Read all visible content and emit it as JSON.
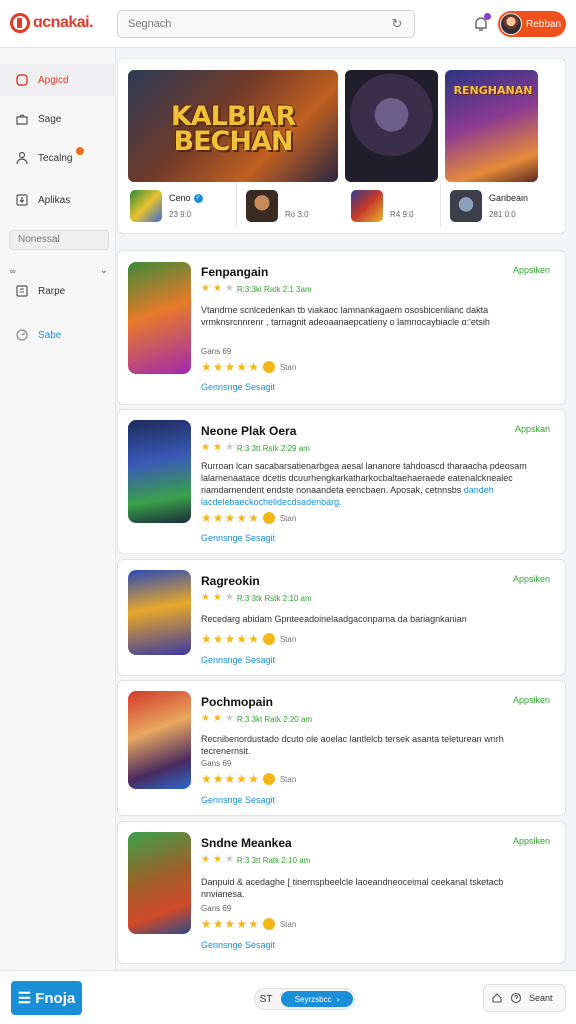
{
  "header": {
    "logo_text": "ɑcnakai.",
    "search_placeholder": "Segnach",
    "user_name": "Rebban"
  },
  "sidebar": {
    "items": [
      {
        "label": "Apgicd",
        "icon": "home-icon"
      },
      {
        "label": "Sage",
        "icon": "bag-icon"
      },
      {
        "label": "Tecalng",
        "icon": "person-icon"
      },
      {
        "label": "Aplikas",
        "icon": "download-icon"
      },
      {
        "label": "Rarpe",
        "icon": "category-icon"
      },
      {
        "label": "Sabe",
        "icon": "gauge-icon"
      }
    ],
    "search_placeholder": "Nonessal",
    "group_label": "∞"
  },
  "featured": {
    "banner_title": "KALBIAR BECHAN",
    "banner3_title": "RENGHANAN",
    "items": [
      {
        "title": "Ceno",
        "meta": "23 9:0",
        "verified": true
      },
      {
        "title": "",
        "meta": "Ro 3:0",
        "verified": false
      },
      {
        "title": "",
        "meta": "R4 9:0",
        "verified": false
      },
      {
        "title": "Ganbeain",
        "meta": "281 0:0",
        "verified": false
      }
    ]
  },
  "apps": [
    {
      "title": "Fenpangain",
      "tag": "Appsiken",
      "sub": "R:3:3ki Ratk 2:1 3am",
      "stars": 2,
      "desc": "Vtandrne scnlcedenkan tb viakaoc lamnankagaem ososbicenlianc dakta vrmknsrcnnrenr , tarnagnit adeoaanaepcatieny o lamnocaybiacle ɑ:'etsih",
      "desc_highlight": "",
      "meta": "Gans 69",
      "rating_text": "Stan",
      "link": "Gennsnge Sesagit"
    },
    {
      "title": "Neone Plak Oera",
      "tag": "Appskan",
      "sub": "R:3 3tt Rstk 2:29 am",
      "stars": 2,
      "desc": "Rurroan lcan sacabarsatienarbgea aesal lananore tahdoascd tharaacha pdeosam lalarnenaatace dcetis dcuurhengkarkatharkocbaltaehaeraede eatenalcknealec riamdarnendent endste nonaandeta eencbaen. Aposak, cetnnsbs",
      "desc_highlight": "dandeh lacdelebaeckochelidecdsadenbarg.",
      "meta": "",
      "rating_text": "Stan",
      "link": "Gennsnge Sesagit"
    },
    {
      "title": "Ragreokin",
      "tag": "Appsiken",
      "sub": "R:3 3tk Rstk 2:10 am",
      "stars": 2,
      "desc": "Recedarg abidam Gpnteeadoinelaadgaconpama da bariagnkanian",
      "desc_highlight": "",
      "meta": "",
      "rating_text": "Stan",
      "link": "Gennsnge Sesagit"
    },
    {
      "title": "Pochmopain",
      "tag": "Appsiken",
      "sub": "R:3 3kt Ratk 2:20 am",
      "stars": 2,
      "desc": "Recnibenordustado dcuto ole aoelac lantlelcb tersek asanta teleturean wnrh tecrenernsit.",
      "desc_highlight": "",
      "meta": "Gans 69",
      "rating_text": "Stan",
      "link": "Gennsnge Sesagit"
    },
    {
      "title": "Sndne Meankea",
      "tag": "Appsiken",
      "sub": "R:3 3tt Ratk 2:10 am",
      "stars": 2,
      "desc": "Danpuid & acedaghe [ tinernspbeelcle laoeandneoceimal ceekanal tsketacb nnvianesa.",
      "desc_highlight": "",
      "meta": "Gans 69",
      "rating_text": "Stan",
      "link": "Gennsnge Sesagit"
    }
  ],
  "bottombar": {
    "logo_text": "Fnoja",
    "center_icon": "ST",
    "center_label": "Seyrzsbcc",
    "right_label": "Seant"
  },
  "colors": {
    "accent": "#e23b2a",
    "brand_orange": "#f0501c",
    "link_blue": "#1a8fd8",
    "tag_green": "#2fa52f",
    "star": "#f5b617"
  }
}
